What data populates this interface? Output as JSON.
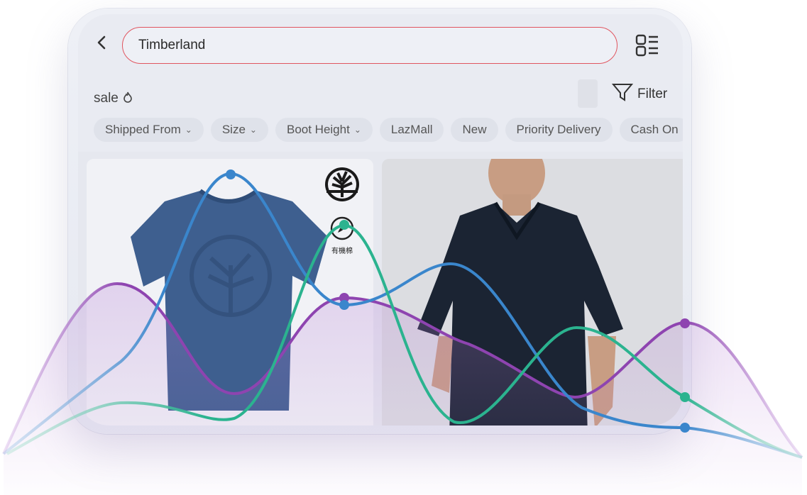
{
  "search": {
    "query": "Timberland"
  },
  "sale_row": {
    "label": "sale"
  },
  "filter": {
    "label": "Filter"
  },
  "chips": [
    {
      "label": "Shipped From",
      "has_dropdown": true
    },
    {
      "label": "Size",
      "has_dropdown": true
    },
    {
      "label": "Boot Height",
      "has_dropdown": true
    },
    {
      "label": "LazMall",
      "has_dropdown": false
    },
    {
      "label": "New",
      "has_dropdown": false
    },
    {
      "label": "Priority Delivery",
      "has_dropdown": false
    },
    {
      "label": "Cash On",
      "has_dropdown": false
    }
  ],
  "product1": {
    "badge_text": "有機棉"
  },
  "colors": {
    "search_border": "#e0555f",
    "line_blue": "#3a86cc",
    "line_teal": "#2bb38f",
    "line_purple": "#8e44b0",
    "shirt_blue": "#3e5f8f",
    "polo_navy": "#1b2433"
  },
  "icons": [
    "back-arrow-icon",
    "layout-toggle-icon",
    "fire-icon",
    "filter-funnel-icon",
    "chevron-down-icon",
    "timberland-tree-logo-icon",
    "organic-cotton-badge-icon"
  ]
}
